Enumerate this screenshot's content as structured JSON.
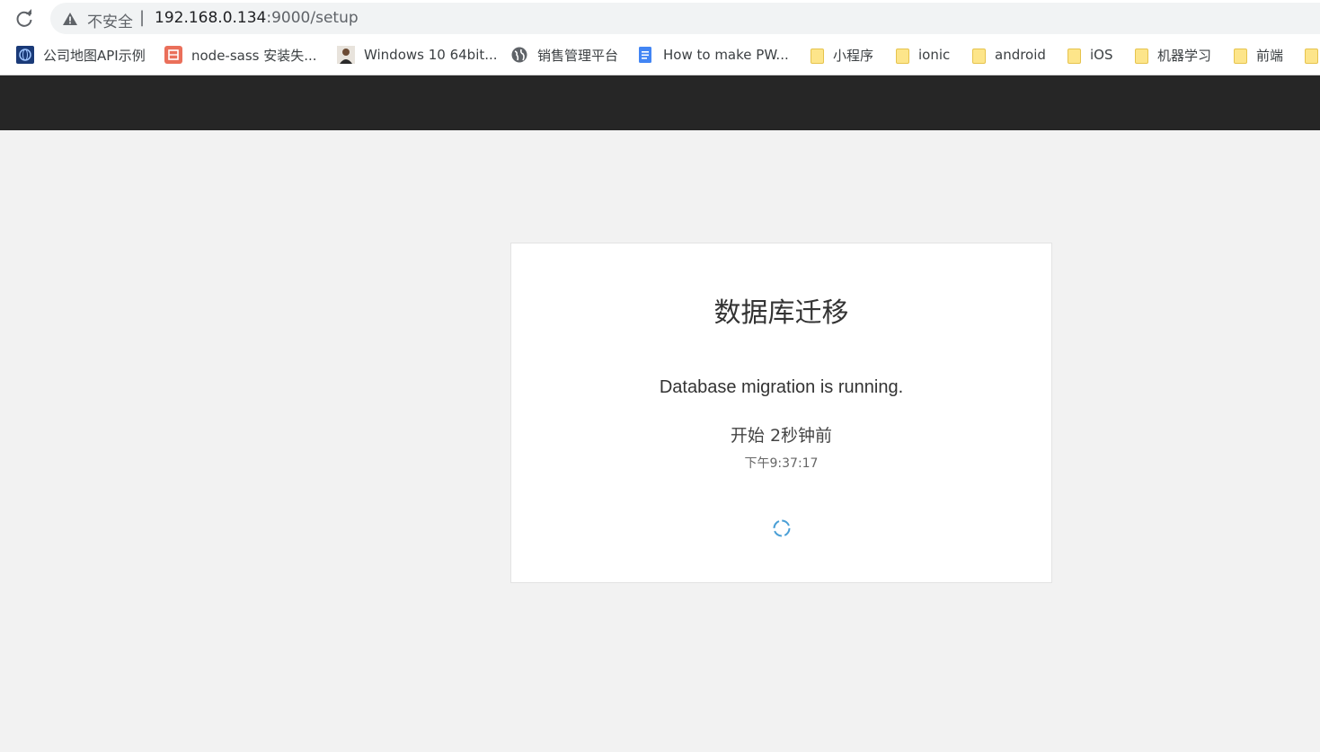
{
  "browser": {
    "security_label": "不安全",
    "separator": "|",
    "url_host": "192.168.0.134",
    "url_rest": ":9000/setup",
    "bookmarks": [
      {
        "label": "公司地图API示例",
        "icon": "globe-dark-icon"
      },
      {
        "label": "node-sass 安装失...",
        "icon": "jianshu-icon"
      },
      {
        "label": "Windows 10 64bit...",
        "icon": "avatar-icon"
      },
      {
        "label": "销售管理平台",
        "icon": "globe-icon"
      },
      {
        "label": "How to make PW...",
        "icon": "document-icon"
      },
      {
        "label": "小程序",
        "icon": "folder-icon"
      },
      {
        "label": "ionic",
        "icon": "folder-icon"
      },
      {
        "label": "android",
        "icon": "folder-icon"
      },
      {
        "label": "iOS",
        "icon": "folder-icon"
      },
      {
        "label": "机器学习",
        "icon": "folder-icon"
      },
      {
        "label": "前端",
        "icon": "folder-icon"
      }
    ]
  },
  "card": {
    "title": "数据库迁移",
    "status": "Database migration is running.",
    "started": "开始 2秒钟前",
    "time": "下午9:37:17"
  },
  "colors": {
    "header_bg": "#262626",
    "page_bg": "#f2f2f2",
    "spinner": "#4a9fd6"
  }
}
